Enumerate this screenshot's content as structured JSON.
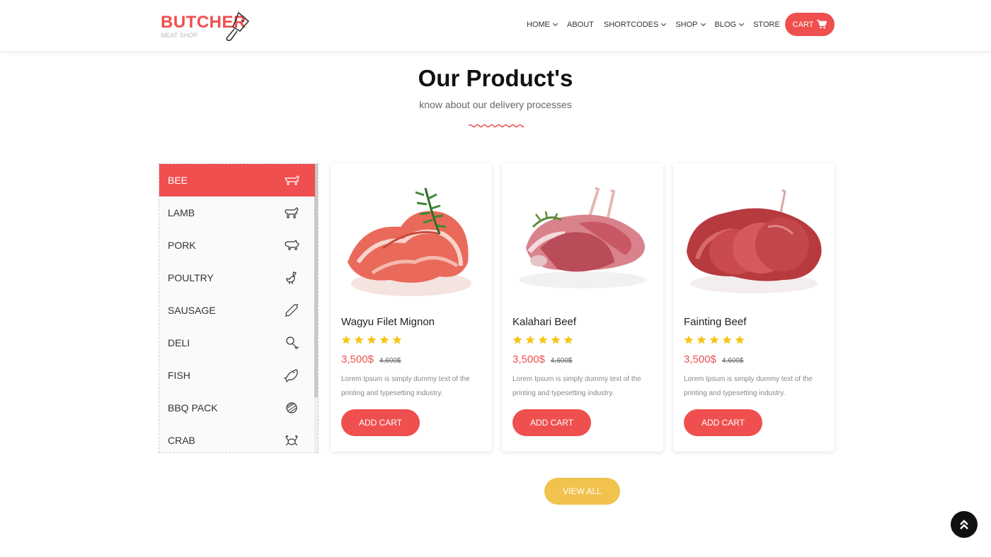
{
  "brand": {
    "name": "BUTCHER",
    "tagline": "MEAT SHOP"
  },
  "nav": {
    "items": [
      {
        "label": "HOME",
        "dropdown": true
      },
      {
        "label": "ABOUT",
        "dropdown": false
      },
      {
        "label": "SHORTCODES",
        "dropdown": true
      },
      {
        "label": "SHOP",
        "dropdown": true
      },
      {
        "label": "BLOG",
        "dropdown": true
      },
      {
        "label": "STORE",
        "dropdown": false
      }
    ],
    "cart_label": "CART"
  },
  "section": {
    "title": "Our Product's",
    "subtitle": "know about our delivery processes"
  },
  "categories": [
    {
      "label": "BEE",
      "icon": "cow-icon",
      "active": true
    },
    {
      "label": "LAMB",
      "icon": "sheep-icon",
      "active": false
    },
    {
      "label": "PORK",
      "icon": "pig-icon",
      "active": false
    },
    {
      "label": "POULTRY",
      "icon": "chicken-icon",
      "active": false
    },
    {
      "label": "SAUSAGE",
      "icon": "sausage-icon",
      "active": false
    },
    {
      "label": "DELI",
      "icon": "drumstick-icon",
      "active": false
    },
    {
      "label": "FISH",
      "icon": "fish-icon",
      "active": false
    },
    {
      "label": "BBQ PACK",
      "icon": "grill-icon",
      "active": false
    },
    {
      "label": "CRAB",
      "icon": "crab-icon",
      "active": false
    }
  ],
  "products": [
    {
      "name": "Wagyu Filet Mignon",
      "rating": 5,
      "price": "3,500$",
      "old_price": "4,600$",
      "description": "Lorem Ipsum is simply dummy text of the printing and typesetting industry.",
      "button": "ADD CART",
      "image": "prosciutto-image"
    },
    {
      "name": "Kalahari Beef",
      "rating": 5,
      "price": "3,500$",
      "old_price": "4,600$",
      "description": "Lorem Ipsum is simply dummy text of the printing and typesetting industry.",
      "button": "ADD CART",
      "image": "lamb-rack-image"
    },
    {
      "name": "Fainting Beef",
      "rating": 5,
      "price": "3,500$",
      "old_price": "4,600$",
      "description": "Lorem Ipsum is simply dummy text of the printing and typesetting industry.",
      "button": "ADD CART",
      "image": "beef-slices-image"
    }
  ],
  "view_all_label": "VIEW ALL",
  "colors": {
    "accent": "#ef4f4f",
    "star": "#f5c518",
    "view_all": "#f1c24d",
    "dark": "#111111"
  }
}
